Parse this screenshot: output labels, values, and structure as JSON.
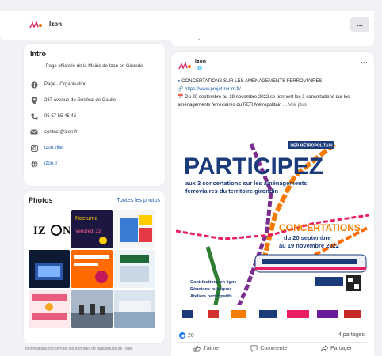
{
  "page": {
    "name": "Izon",
    "more_label": "..."
  },
  "intro": {
    "title": "Intro",
    "description": "Page officielle de la Mairie de Izon en Gironde",
    "items": [
      {
        "icon": "info-icon",
        "text": "Page · Organisation"
      },
      {
        "icon": "location-pin-icon",
        "text": "237 avenue du Général de Gaulle"
      },
      {
        "icon": "phone-icon",
        "text": "05 57 55 45 46"
      },
      {
        "icon": "email-icon",
        "text": "contact@izon.fr"
      },
      {
        "icon": "instagram-icon",
        "text": "izon.ville"
      },
      {
        "icon": "globe-icon",
        "text": "izon.fr"
      }
    ]
  },
  "photos": {
    "title": "Photos",
    "all_label": "Toutes les photos",
    "tiles": [
      {
        "label": "IZON",
        "bg": "#ffffff"
      },
      {
        "label": "Vendredi 23",
        "bg": "#1b1740"
      },
      {
        "label": "IZON",
        "bg": "#2b2b2b"
      },
      {
        "label": "",
        "bg": "#0d1a33"
      },
      {
        "label": "",
        "bg": "#ff6a00"
      },
      {
        "label": "",
        "bg": "#eef3f7"
      },
      {
        "label": "",
        "bg": "#e85c7d"
      },
      {
        "label": "",
        "bg": "#7a8ea8"
      },
      {
        "label": "",
        "bg": "#f6d8df"
      }
    ]
  },
  "bottom_note": "Informations concernant les données de statistiques de Page",
  "post": {
    "author": "Izon",
    "meta": "· 🌐",
    "more": "···",
    "headline": "CONCERTATIONS SUR LES AMÉNAGEMENTS FERROVIAIRES",
    "link": "https://www.projet-rer-m.fr/",
    "body": "Du 20 septembre au 19 novembre 2022 se tiennent les 3 concertations sur les aménagements ferroviaires du RER Métropolitain ...",
    "see_more": "Voir plus",
    "poster": {
      "top_banner": "RER MÉTROPOLITAIN",
      "title": "PARTICIPEZ",
      "subtitle1": "aux 3 concertations sur les aménagements",
      "subtitle2": "ferroviaires du territoire girondin",
      "conc_title": "CONCERTATIONS",
      "conc_dates1": "du 20 septembre",
      "conc_dates2": "au 19 novembre 2022",
      "bullets": [
        "Contributions en ligne",
        "Réunions publiques",
        "Ateliers participatifs"
      ]
    },
    "likes_count": "20",
    "shares": "4 partages",
    "actions": {
      "like": "J'aime",
      "comment": "Commenter",
      "share": "Partager"
    }
  }
}
